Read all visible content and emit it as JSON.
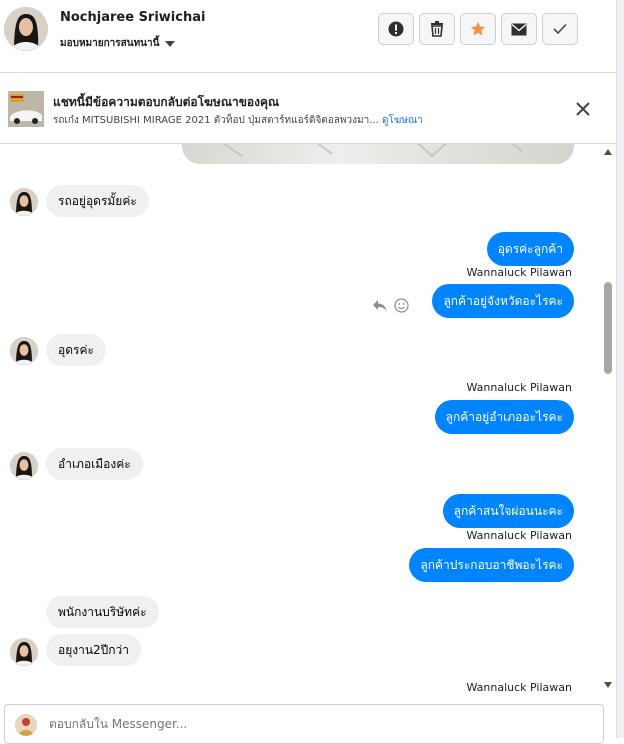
{
  "header": {
    "contact_name": "Nochjaree Sriwichai",
    "assign_label": "มอบหมายการสนทนานี้",
    "actions": [
      {
        "name": "report-spam-button",
        "icon": "exclamation-circle-icon"
      },
      {
        "name": "delete-button",
        "icon": "trash-icon"
      },
      {
        "name": "star-button",
        "icon": "star-icon"
      },
      {
        "name": "mark-unread-button",
        "icon": "envelope-icon"
      },
      {
        "name": "mark-done-button",
        "icon": "check-icon"
      }
    ]
  },
  "banner": {
    "title": "แชทนี้มีข้อความตอบกลับต่อโฆษณาของคุณ",
    "subtitle": "รถเก๋ง MITSUBISHI MIRAGE 2021 ตัวท็อป ปุ่มสตาร์ทแอร์ดิจิตอลพวงมา...",
    "link": "ดูโฆษณา"
  },
  "messages": [
    {
      "dir": "in",
      "text": "รถอยู่อุดรมั้ยค่ะ"
    },
    {
      "dir": "out",
      "text": "อุดรค่ะลูกค้า"
    },
    {
      "dir": "sender",
      "text": "Wannaluck Pilawan"
    },
    {
      "dir": "out",
      "text": "ลูกค้าอยู่จังหวัดอะไรคะ"
    },
    {
      "dir": "in",
      "text": "อุดรค่ะ"
    },
    {
      "dir": "sender",
      "text": "Wannaluck Pilawan"
    },
    {
      "dir": "out",
      "text": "ลูกค้าอยู่อำเภออะไรคะ"
    },
    {
      "dir": "in",
      "text": "อำเภอเมืองค่ะ"
    },
    {
      "dir": "out",
      "text": "ลูกค้าสนใจผ่อนนะคะ"
    },
    {
      "dir": "sender",
      "text": "Wannaluck Pilawan"
    },
    {
      "dir": "out",
      "text": "ลูกค้าประกอบอาชีพอะไรคะ"
    },
    {
      "dir": "in",
      "text": "พนักงานบริษัทค่ะ"
    },
    {
      "dir": "in",
      "text": "อยุงาน2ปีกว่า"
    },
    {
      "dir": "sender",
      "text": "Wannaluck Pilawan"
    }
  ],
  "composer": {
    "placeholder": "ตอบกลับใน Messenger..."
  },
  "colors": {
    "accent": "#0084ff",
    "incoming_bubble": "#f0f0f0",
    "star": "#f7923a",
    "link": "#1877f2"
  }
}
